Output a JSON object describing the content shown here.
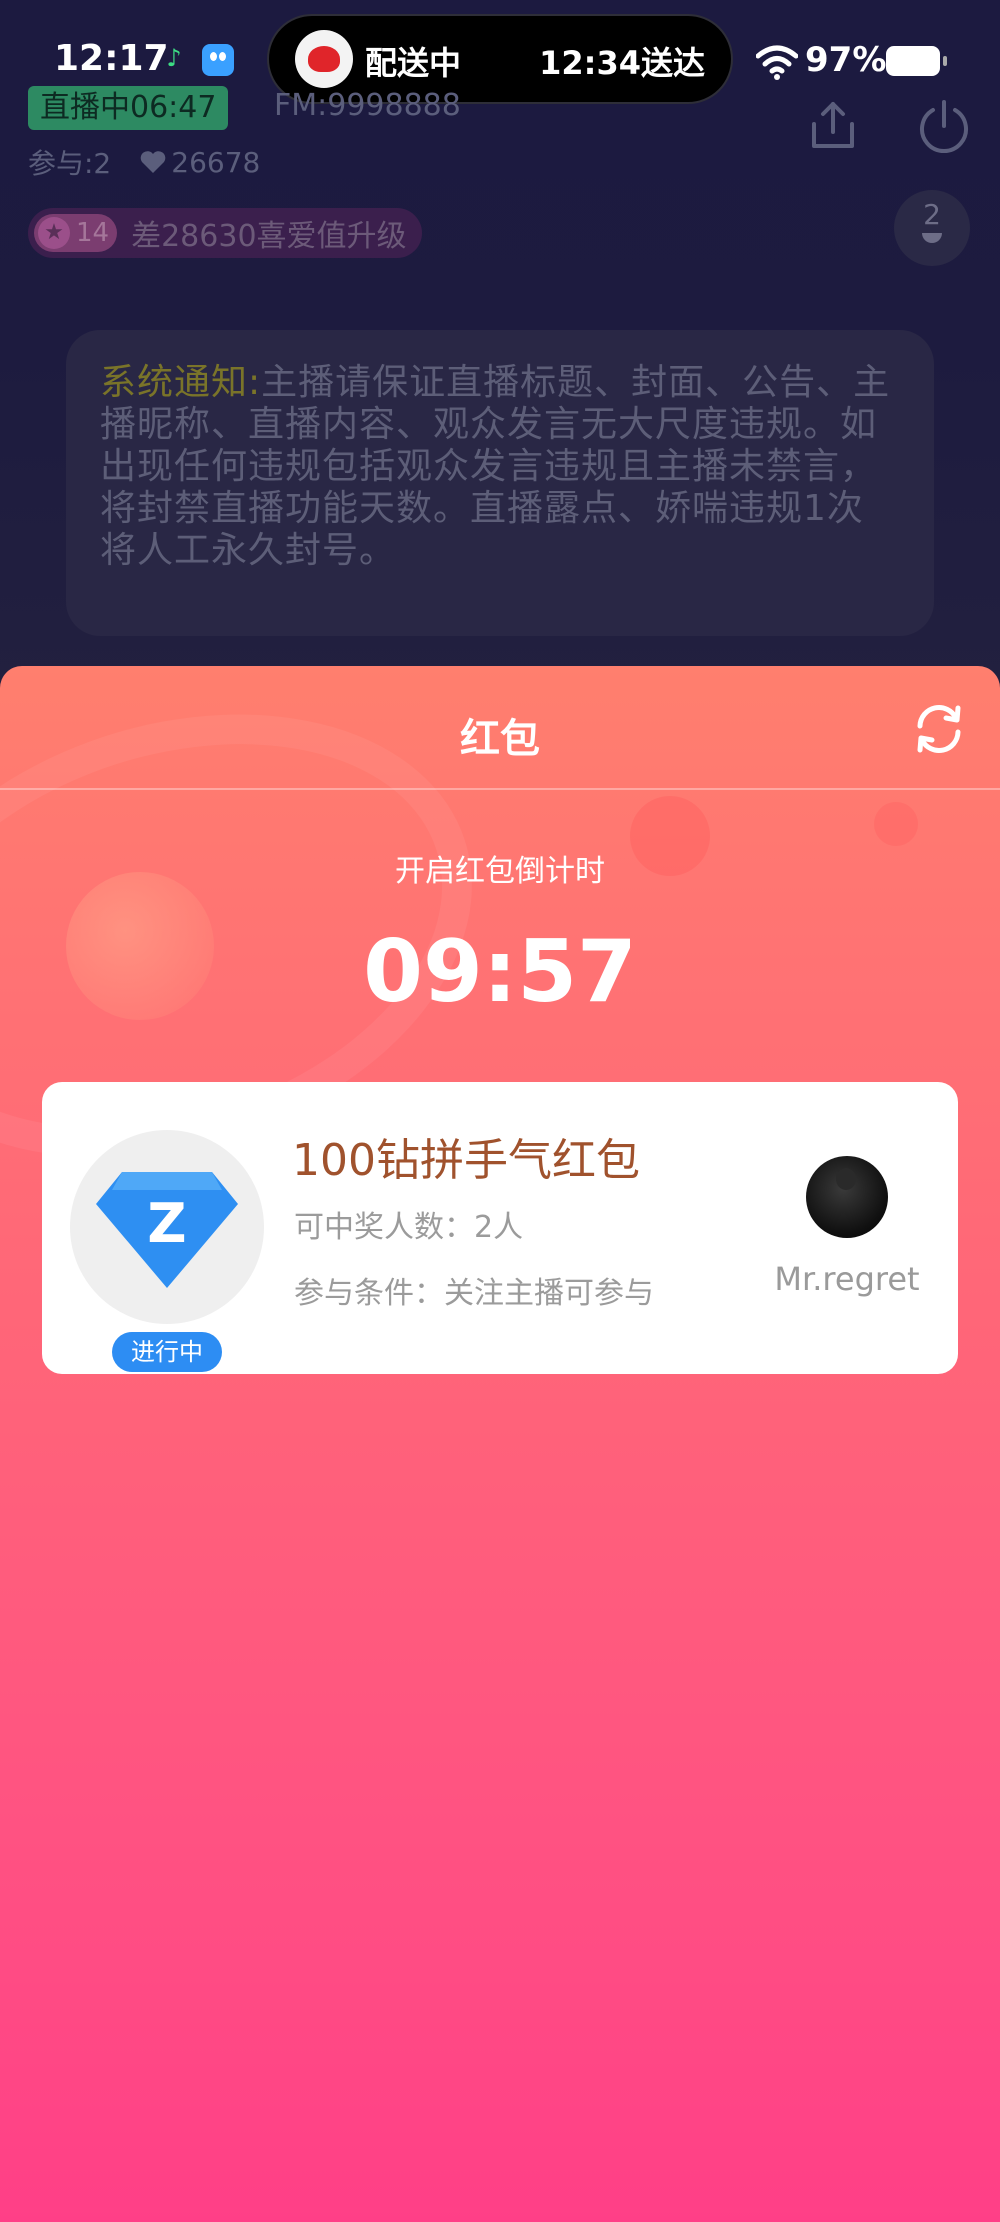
{
  "status_bar": {
    "time": "12:17",
    "delivery_left": "配送中",
    "delivery_right": "12:34送达",
    "battery": "97%",
    "icons": [
      "music-app-icon",
      "qq-app-icon",
      "delivery-rider-icon",
      "wifi-icon",
      "battery-icon"
    ]
  },
  "stream": {
    "live_badge": "直播中06:47",
    "fm": "FM:9998888",
    "participants": "参与:2",
    "likes": "26678",
    "level": "14",
    "level_text": "差28630喜爱值升级",
    "mic_count": "2"
  },
  "notice": {
    "label": "系统通知:",
    "text": "主播请保证直播标题、封面、公告、主播昵称、直播内容、观众发言无大尺度违规。如出现任何违规包括观众发言违规且主播未禁言，将封禁直播功能天数。直播露点、娇喘违规1次将人工永久封号。"
  },
  "red_packet": {
    "title": "红包",
    "countdown_label": "开启红包倒计时",
    "countdown": "09:57",
    "card": {
      "gem_letter": "Z",
      "status": "进行中",
      "name": "100钻拼手气红包",
      "winners": "可中奖人数：2人",
      "condition": "参与条件：关注主播可参与",
      "sender": "Mr.regret"
    }
  },
  "colors": {
    "sheet_top": "#ff7f6e",
    "sheet_bottom": "#ff3f87",
    "card_title": "#a0522d",
    "status_tag": "#2d8df3",
    "gem_blue": "#2e8ff2"
  }
}
